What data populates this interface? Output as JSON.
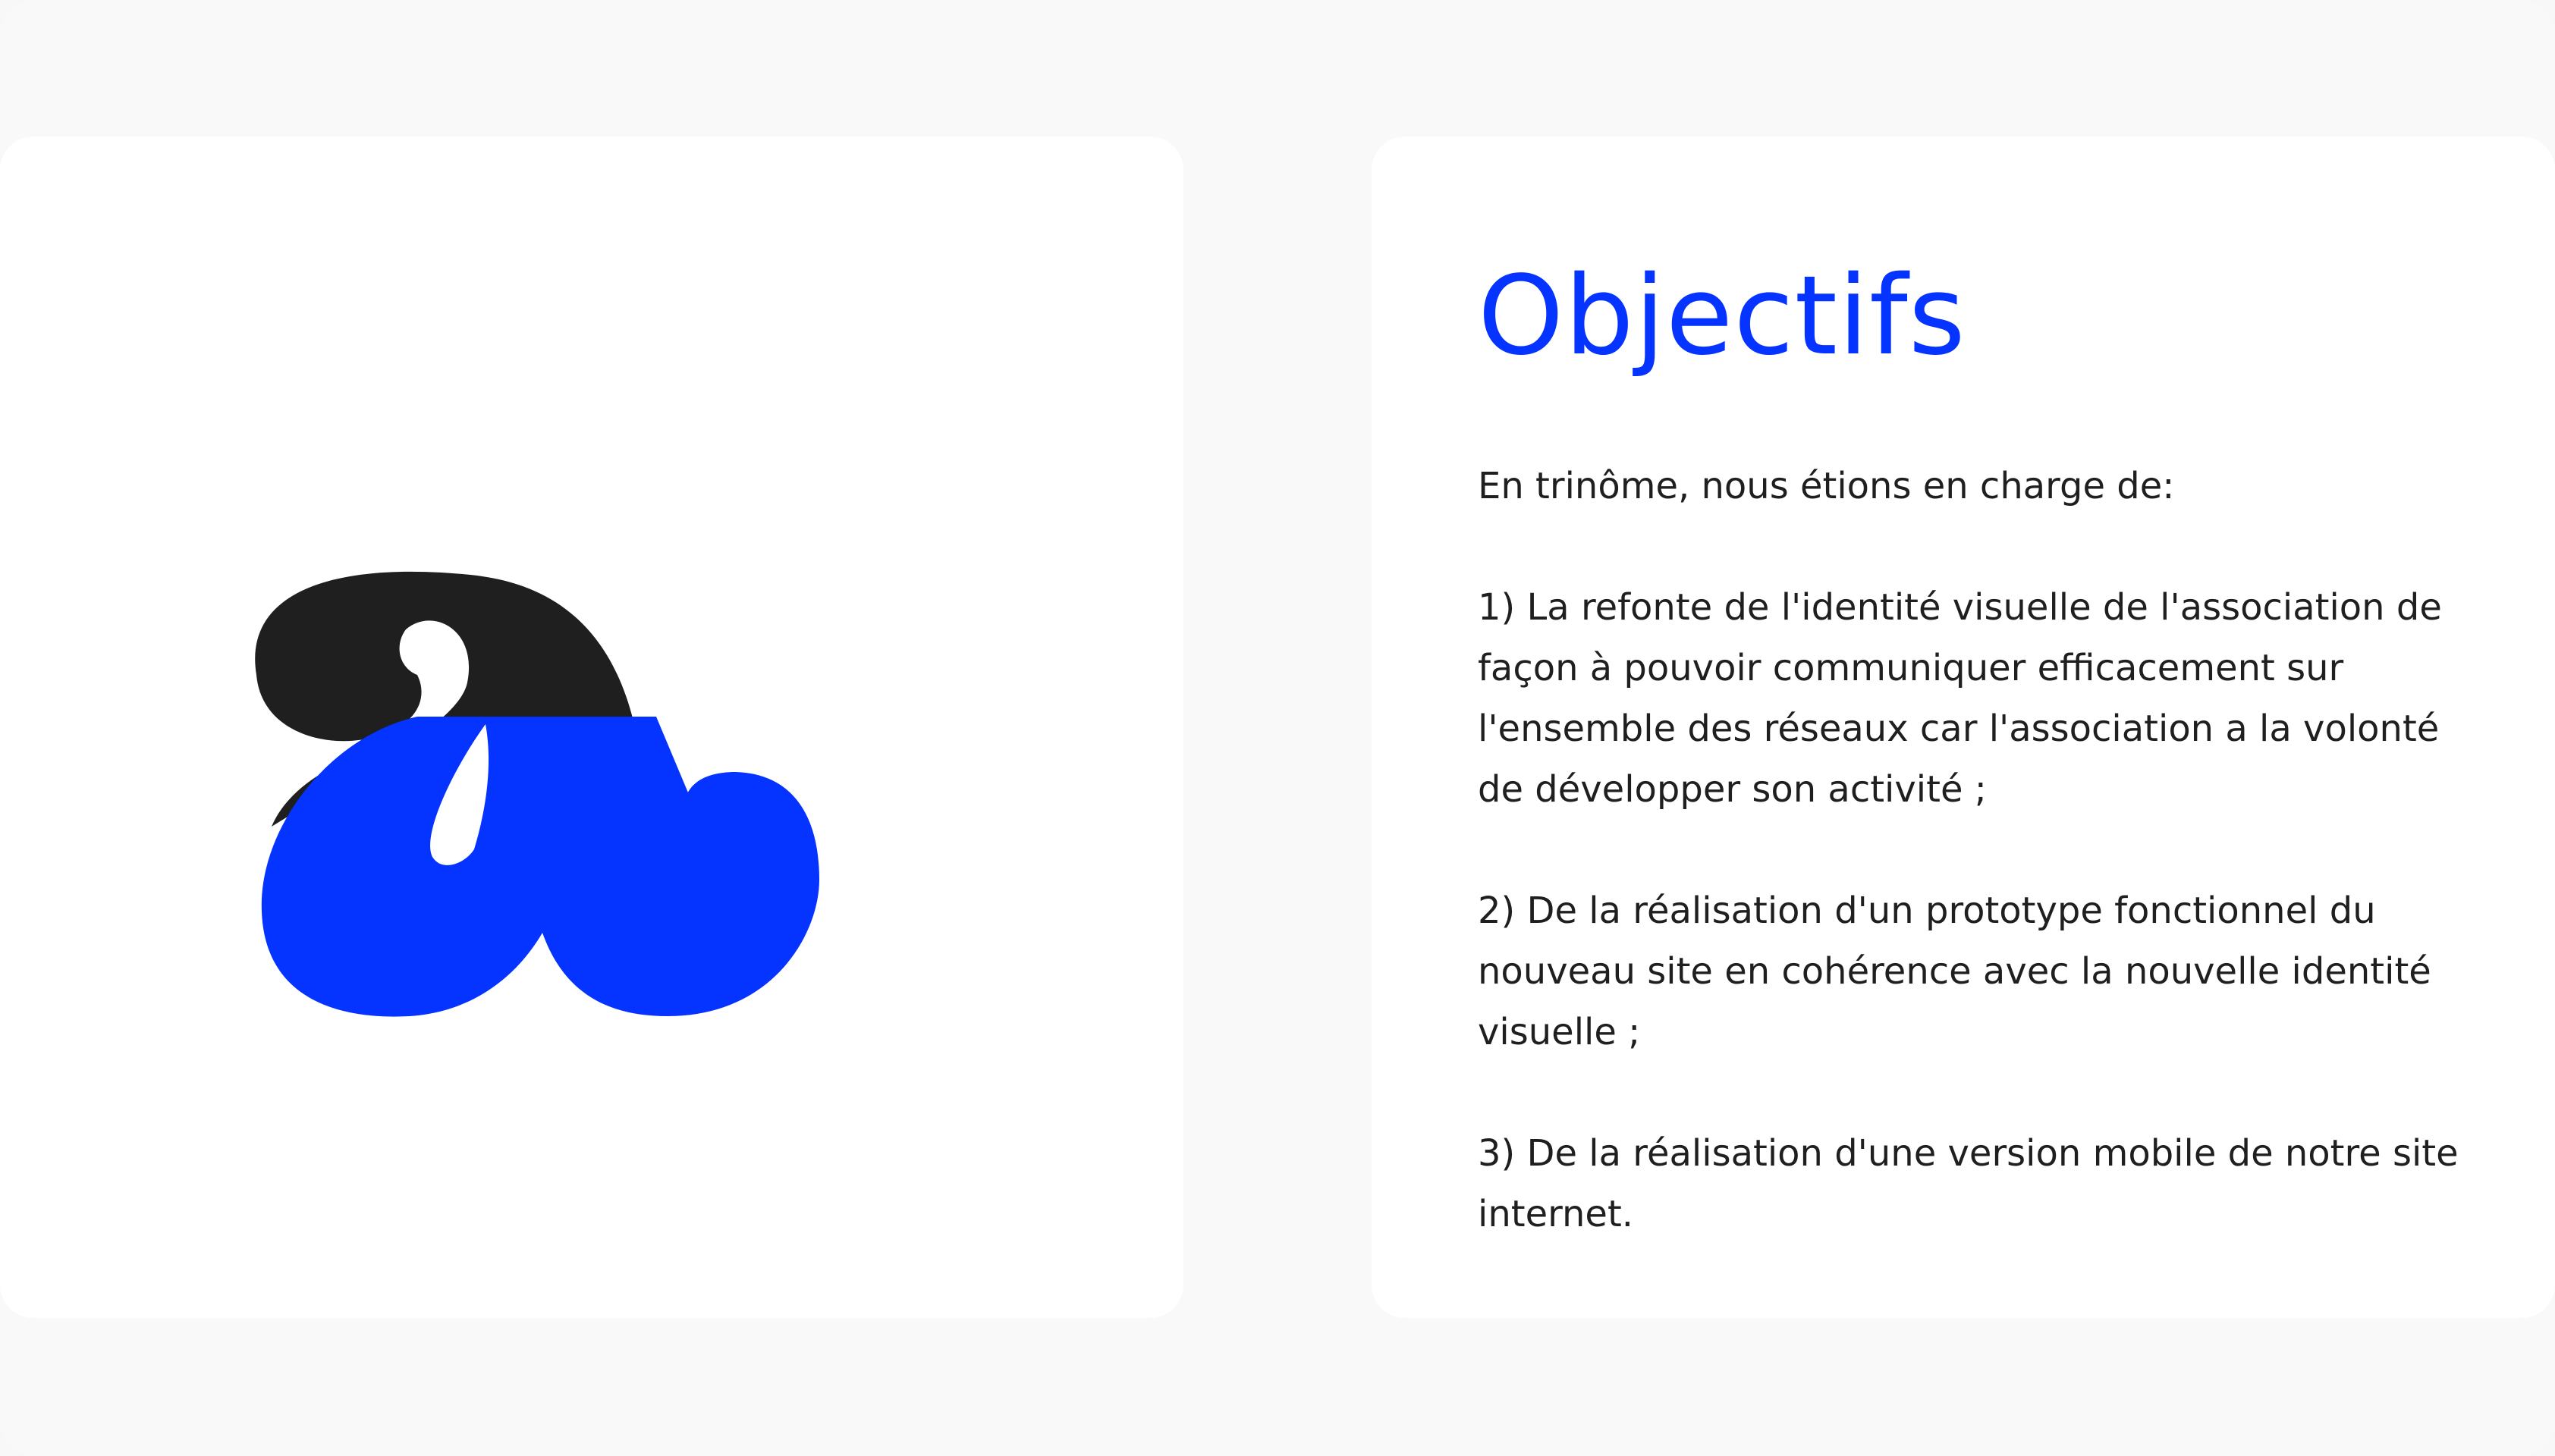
{
  "logo": {
    "icon": "aa-monogram-logo",
    "colors": {
      "top_letter": "#1f1f1f",
      "bottom_letter": "#0533ff"
    }
  },
  "objectives": {
    "title": "Objectifs",
    "intro": "En trinôme, nous étions en charge de:",
    "items": [
      "1) La refonte de l'identité visuelle de l'association de façon à pouvoir communiquer efficacement sur l'ensemble des réseaux car l'association a la volonté de développer son activité ;",
      "2) De la réalisation d'un prototype fonctionnel du nouveau site en cohérence avec la nouvelle identité visuelle ;",
      "3) De la réalisation d'une version mobile de notre site internet."
    ]
  },
  "colors": {
    "accent": "#0533ff",
    "text": "#1f1f1f",
    "card": "#ffffff",
    "background": "#f9f9f9"
  }
}
